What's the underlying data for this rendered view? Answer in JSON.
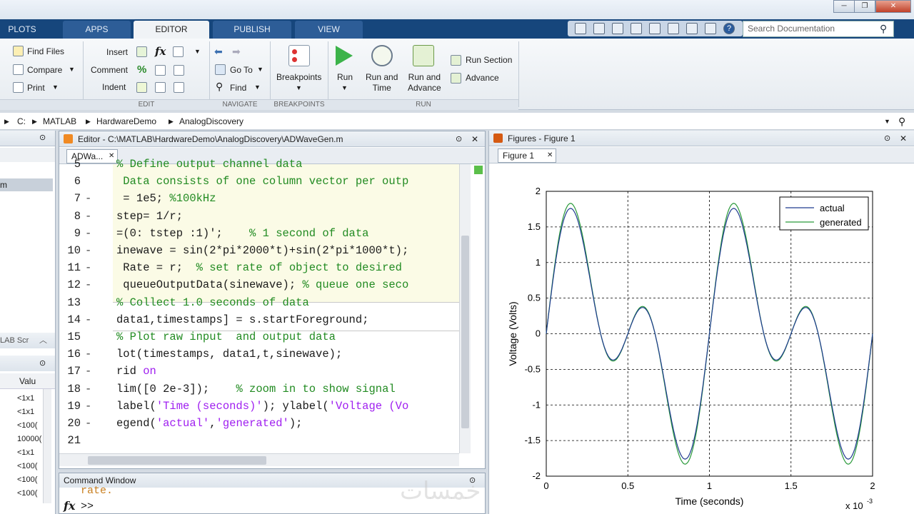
{
  "tabs": [
    "PLOTS",
    "APPS",
    "EDITOR",
    "PUBLISH",
    "VIEW"
  ],
  "search_placeholder": "Search Documentation",
  "ribbon": {
    "file": {
      "find_files": "Find Files",
      "compare": "Compare",
      "print": "Print"
    },
    "edit": {
      "insert": "Insert",
      "comment": "Comment",
      "indent": "Indent",
      "fx": "fx"
    },
    "navigate": {
      "go_to": "Go To",
      "find": "Find"
    },
    "breakpoints": {
      "label": "Breakpoints"
    },
    "run": {
      "run": "Run",
      "run_and_time": "Run and\nTime",
      "run_and_advance": "Run and\nAdvance",
      "run_section": "Run Section",
      "advance": "Advance"
    },
    "sections": {
      "edit": "EDIT",
      "navigate": "NAVIGATE",
      "breakpoints": "BREAKPOINTS",
      "run": "RUN"
    }
  },
  "path": [
    "C:",
    "MATLAB",
    "HardwareDemo",
    "AnalogDiscovery"
  ],
  "left_pane": {
    "selected": "m",
    "workspace_label": "LAB Scr",
    "value_header": "Valu",
    "values": [
      "<1x1",
      "<1x1",
      "<100(",
      "10000(",
      "<1x1",
      "<100(",
      "<100(",
      "<100("
    ]
  },
  "editor": {
    "title": "Editor - C:\\MATLAB\\HardwareDemo\\AnalogDiscovery\\ADWaveGen.m",
    "tab": "ADWa...",
    "lines": [
      {
        "n": "5",
        "dash": "",
        "segs": [
          {
            "t": "% Define output channel data",
            "c": "cmt"
          }
        ]
      },
      {
        "n": "6",
        "dash": "",
        "segs": [
          {
            "t": " Data consists of one column vector per outp",
            "c": "cmt"
          }
        ]
      },
      {
        "n": "7",
        "dash": "-",
        "segs": [
          {
            "t": " = 1e5; ",
            "c": ""
          },
          {
            "t": "%100kHz",
            "c": "cmt"
          }
        ]
      },
      {
        "n": "8",
        "dash": "-",
        "segs": [
          {
            "t": "step= 1/r;",
            "c": ""
          }
        ]
      },
      {
        "n": "9",
        "dash": "-",
        "segs": [
          {
            "t": "=(0: tstep :1)';    ",
            "c": ""
          },
          {
            "t": "% 1 second of data",
            "c": "cmt"
          }
        ]
      },
      {
        "n": "10",
        "dash": "-",
        "segs": [
          {
            "t": "inewave = sin(2*pi*2000*t)+sin(2*pi*1000*t);",
            "c": ""
          }
        ]
      },
      {
        "n": "11",
        "dash": "-",
        "segs": [
          {
            "t": " Rate = r;  ",
            "c": ""
          },
          {
            "t": "% set rate of object to desired",
            "c": "cmt"
          }
        ]
      },
      {
        "n": "12",
        "dash": "-",
        "segs": [
          {
            "t": " queueOutputData(sinewave); ",
            "c": ""
          },
          {
            "t": "% queue one seco",
            "c": "cmt"
          }
        ]
      },
      {
        "n": "13",
        "dash": "",
        "segs": [
          {
            "t": "% Collect 1.0 seconds of data",
            "c": "cmt"
          }
        ]
      },
      {
        "n": "14",
        "dash": "-",
        "segs": [
          {
            "t": "data1,timestamps] = s.startForeground;",
            "c": ""
          }
        ]
      },
      {
        "n": "15",
        "dash": "",
        "segs": [
          {
            "t": "% Plot raw input  and output data",
            "c": "cmt"
          }
        ]
      },
      {
        "n": "16",
        "dash": "-",
        "segs": [
          {
            "t": "lot(timestamps, data1,t,sinewave);",
            "c": ""
          }
        ]
      },
      {
        "n": "17",
        "dash": "-",
        "segs": [
          {
            "t": "rid ",
            "c": ""
          },
          {
            "t": "on",
            "c": "kw"
          }
        ]
      },
      {
        "n": "18",
        "dash": "-",
        "segs": [
          {
            "t": "lim([0 2e-3]);    ",
            "c": ""
          },
          {
            "t": "% zoom in to show signal",
            "c": "cmt"
          }
        ]
      },
      {
        "n": "19",
        "dash": "-",
        "segs": [
          {
            "t": "label(",
            "c": ""
          },
          {
            "t": "'Time (seconds)'",
            "c": "str"
          },
          {
            "t": "); ylabel(",
            "c": ""
          },
          {
            "t": "'Voltage (Vo",
            "c": "str"
          }
        ]
      },
      {
        "n": "20",
        "dash": "-",
        "segs": [
          {
            "t": "egend(",
            "c": ""
          },
          {
            "t": "'actual'",
            "c": "str"
          },
          {
            "t": ",",
            "c": ""
          },
          {
            "t": "'generated'",
            "c": "str"
          },
          {
            "t": ");",
            "c": ""
          }
        ]
      },
      {
        "n": "21",
        "dash": "",
        "segs": []
      }
    ]
  },
  "figure": {
    "title": "Figures - Figure 1",
    "tab": "Figure 1"
  },
  "command_window": {
    "title": "Command Window",
    "partial_text": "rate.",
    "prompt": ">>",
    "fx": "fx"
  },
  "watermark": "خمسات",
  "chart_data": {
    "type": "line",
    "xlabel": "Time (seconds)",
    "ylabel": "Voltage (Volts)",
    "x_multiplier": "x 10",
    "x_multiplier_exp": "-3",
    "xlim": [
      0,
      2
    ],
    "ylim": [
      -2,
      2
    ],
    "xticks": [
      "0",
      "0.5",
      "1",
      "1.5",
      "2"
    ],
    "yticks": [
      "2",
      "1.5",
      "1",
      "0.5",
      "0",
      "-0.5",
      "-1",
      "-1.5",
      "-2"
    ],
    "grid": true,
    "legend_position": "top-right",
    "series": [
      {
        "name": "actual",
        "color": "#1f3b8f",
        "function": "sin(2*pi*2000*t)+sin(2*pi*1000*t)",
        "scale": 1.0
      },
      {
        "name": "generated",
        "color": "#2a9a3a",
        "function": "sin(2*pi*2000*t)+sin(2*pi*1000*t)",
        "scale": 1.04
      }
    ]
  }
}
